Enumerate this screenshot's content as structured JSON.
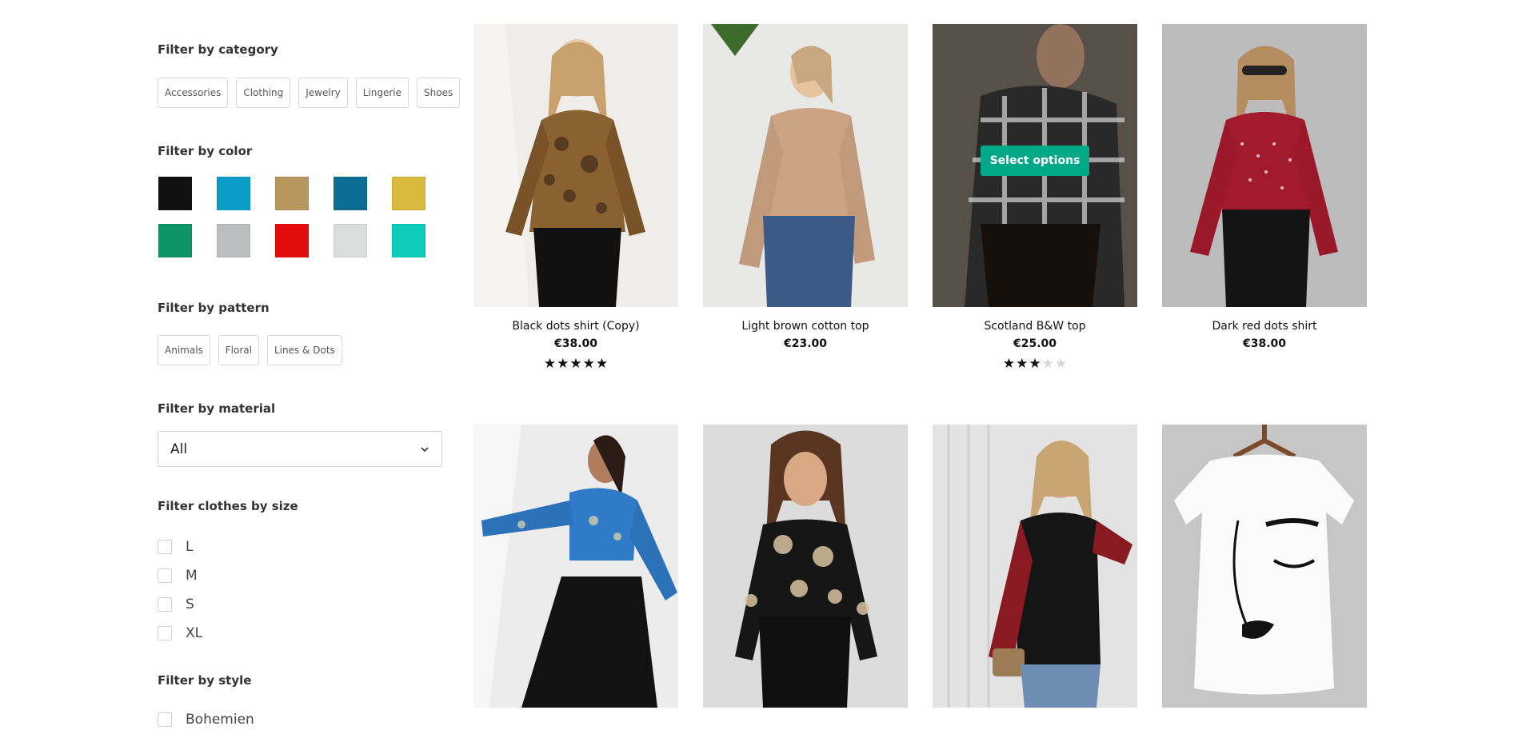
{
  "filters": {
    "category": {
      "title": "Filter by category",
      "chips": [
        "Accessories",
        "Clothing",
        "Jewelry",
        "Lingerie",
        "Shoes"
      ]
    },
    "color": {
      "title": "Filter by color",
      "swatches": [
        "#111111",
        "#0a9dc8",
        "#b8975f",
        "#0a6d91",
        "#d9b93e",
        "#0e9466",
        "#bcbdbe",
        "#e30b0b",
        "#dcdddd",
        "#0bcdb9"
      ]
    },
    "pattern": {
      "title": "Filter by pattern",
      "chips": [
        "Animals",
        "Floral",
        "Lines & Dots"
      ]
    },
    "material": {
      "title": "Filter by material",
      "selected": "All"
    },
    "size": {
      "title": "Filter clothes by size",
      "options": [
        "L",
        "M",
        "S",
        "XL"
      ]
    },
    "style": {
      "title": "Filter by style",
      "options": [
        "Bohemien"
      ]
    }
  },
  "products": [
    {
      "name": "Black dots shirt (Copy)",
      "price": "€38.00",
      "rating": 5,
      "image": "woman-floral-lace-top"
    },
    {
      "name": "Light brown cotton top",
      "price": "€23.00",
      "image": "woman-beige-top"
    },
    {
      "name": "Scotland B&W top",
      "price": "€25.00",
      "rating": 3,
      "hovered": true,
      "button": "Select options",
      "image": "woman-plaid-top"
    },
    {
      "name": "Dark red dots shirt",
      "price": "€38.00",
      "image": "woman-red-polka-top"
    },
    {
      "name": "",
      "price": "",
      "image": "woman-blue-print-crop-top"
    },
    {
      "name": "",
      "price": "",
      "image": "woman-floral-square-neck-top"
    },
    {
      "name": "",
      "price": "",
      "image": "woman-black-red-floral-sleeve-top"
    },
    {
      "name": "",
      "price": "",
      "image": "white-face-print-tee"
    }
  ]
}
